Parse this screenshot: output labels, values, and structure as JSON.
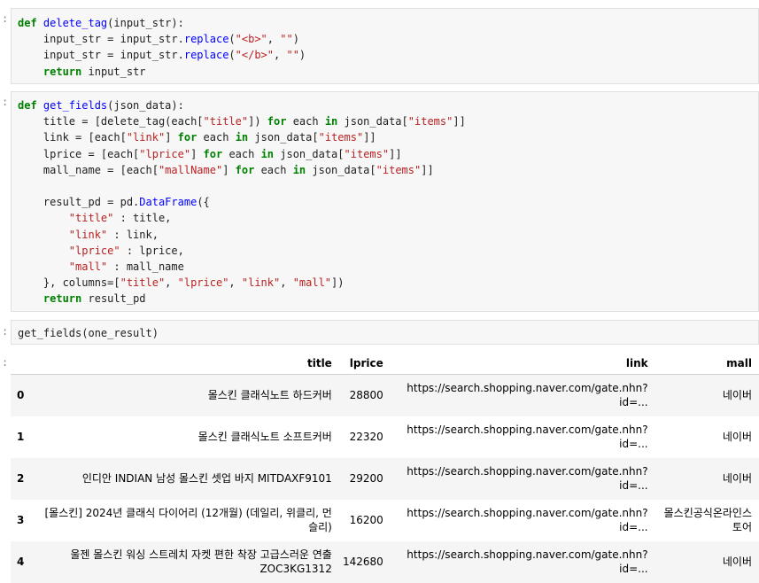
{
  "cells": {
    "cell1": {
      "lines": [
        [
          {
            "t": "def ",
            "c": "kw"
          },
          {
            "t": "delete_tag",
            "c": "fn"
          },
          {
            "t": "(input_str):",
            "c": "pl"
          }
        ],
        [
          {
            "t": "    input_str = input_str.",
            "c": "pl"
          },
          {
            "t": "replace",
            "c": "fn"
          },
          {
            "t": "(",
            "c": "pl"
          },
          {
            "t": "\"<b>\"",
            "c": "st"
          },
          {
            "t": ", ",
            "c": "pl"
          },
          {
            "t": "\"\"",
            "c": "st"
          },
          {
            "t": ")",
            "c": "pl"
          }
        ],
        [
          {
            "t": "    input_str = input_str.",
            "c": "pl"
          },
          {
            "t": "replace",
            "c": "fn"
          },
          {
            "t": "(",
            "c": "pl"
          },
          {
            "t": "\"</b>\"",
            "c": "st"
          },
          {
            "t": ", ",
            "c": "pl"
          },
          {
            "t": "\"\"",
            "c": "st"
          },
          {
            "t": ")",
            "c": "pl"
          }
        ],
        [
          {
            "t": "    ",
            "c": "pl"
          },
          {
            "t": "return",
            "c": "kw"
          },
          {
            "t": " input_str",
            "c": "pl"
          }
        ]
      ]
    },
    "cell2": {
      "lines": [
        [
          {
            "t": "def ",
            "c": "kw"
          },
          {
            "t": "get_fields",
            "c": "fn"
          },
          {
            "t": "(json_data):",
            "c": "pl"
          }
        ],
        [
          {
            "t": "    title = [delete_tag(each[",
            "c": "pl"
          },
          {
            "t": "\"title\"",
            "c": "st"
          },
          {
            "t": "]) ",
            "c": "pl"
          },
          {
            "t": "for",
            "c": "kw"
          },
          {
            "t": " each ",
            "c": "pl"
          },
          {
            "t": "in",
            "c": "kw"
          },
          {
            "t": " json_data[",
            "c": "pl"
          },
          {
            "t": "\"items\"",
            "c": "st"
          },
          {
            "t": "]]",
            "c": "pl"
          }
        ],
        [
          {
            "t": "    link = [each[",
            "c": "pl"
          },
          {
            "t": "\"link\"",
            "c": "st"
          },
          {
            "t": "] ",
            "c": "pl"
          },
          {
            "t": "for",
            "c": "kw"
          },
          {
            "t": " each ",
            "c": "pl"
          },
          {
            "t": "in",
            "c": "kw"
          },
          {
            "t": " json_data[",
            "c": "pl"
          },
          {
            "t": "\"items\"",
            "c": "st"
          },
          {
            "t": "]]",
            "c": "pl"
          }
        ],
        [
          {
            "t": "    lprice = [each[",
            "c": "pl"
          },
          {
            "t": "\"lprice\"",
            "c": "st"
          },
          {
            "t": "] ",
            "c": "pl"
          },
          {
            "t": "for",
            "c": "kw"
          },
          {
            "t": " each ",
            "c": "pl"
          },
          {
            "t": "in",
            "c": "kw"
          },
          {
            "t": " json_data[",
            "c": "pl"
          },
          {
            "t": "\"items\"",
            "c": "st"
          },
          {
            "t": "]]",
            "c": "pl"
          }
        ],
        [
          {
            "t": "    mall_name = [each[",
            "c": "pl"
          },
          {
            "t": "\"mallName\"",
            "c": "st"
          },
          {
            "t": "] ",
            "c": "pl"
          },
          {
            "t": "for",
            "c": "kw"
          },
          {
            "t": " each ",
            "c": "pl"
          },
          {
            "t": "in",
            "c": "kw"
          },
          {
            "t": " json_data[",
            "c": "pl"
          },
          {
            "t": "\"items\"",
            "c": "st"
          },
          {
            "t": "]]",
            "c": "pl"
          }
        ],
        [
          {
            "t": "",
            "c": "pl"
          }
        ],
        [
          {
            "t": "    result_pd = pd.",
            "c": "pl"
          },
          {
            "t": "DataFrame",
            "c": "fn"
          },
          {
            "t": "({",
            "c": "pl"
          }
        ],
        [
          {
            "t": "        ",
            "c": "pl"
          },
          {
            "t": "\"title\"",
            "c": "st"
          },
          {
            "t": " : title,",
            "c": "pl"
          }
        ],
        [
          {
            "t": "        ",
            "c": "pl"
          },
          {
            "t": "\"link\"",
            "c": "st"
          },
          {
            "t": " : link,",
            "c": "pl"
          }
        ],
        [
          {
            "t": "        ",
            "c": "pl"
          },
          {
            "t": "\"lprice\"",
            "c": "st"
          },
          {
            "t": " : lprice,",
            "c": "pl"
          }
        ],
        [
          {
            "t": "        ",
            "c": "pl"
          },
          {
            "t": "\"mall\"",
            "c": "st"
          },
          {
            "t": " : mall_name",
            "c": "pl"
          }
        ],
        [
          {
            "t": "    }, columns=[",
            "c": "pl"
          },
          {
            "t": "\"title\"",
            "c": "st"
          },
          {
            "t": ", ",
            "c": "pl"
          },
          {
            "t": "\"lprice\"",
            "c": "st"
          },
          {
            "t": ", ",
            "c": "pl"
          },
          {
            "t": "\"link\"",
            "c": "st"
          },
          {
            "t": ", ",
            "c": "pl"
          },
          {
            "t": "\"mall\"",
            "c": "st"
          },
          {
            "t": "])",
            "c": "pl"
          }
        ],
        [
          {
            "t": "    ",
            "c": "pl"
          },
          {
            "t": "return",
            "c": "kw"
          },
          {
            "t": " result_pd",
            "c": "pl"
          }
        ]
      ]
    },
    "cell3": {
      "lines": [
        [
          {
            "t": "get_fields(one_result)",
            "c": "pl"
          }
        ]
      ]
    }
  },
  "prompts": {
    "p1": ":",
    "p2": ":",
    "p3": ":",
    "p4": ":"
  },
  "dataframe": {
    "columns": [
      "title",
      "lprice",
      "link",
      "mall"
    ],
    "rows": [
      {
        "index": "0",
        "title": "몰스킨 클래식노트 하드커버",
        "lprice": "28800",
        "link": "https://search.shopping.naver.com/gate.nhn?id=...",
        "mall": "네이버"
      },
      {
        "index": "1",
        "title": "몰스킨 클래식노트 소프트커버",
        "lprice": "22320",
        "link": "https://search.shopping.naver.com/gate.nhn?id=...",
        "mall": "네이버"
      },
      {
        "index": "2",
        "title": "인디안 INDIAN 남성 몰스킨 셋업 바지 MITDAXF9101",
        "lprice": "29200",
        "link": "https://search.shopping.naver.com/gate.nhn?id=...",
        "mall": "네이버"
      },
      {
        "index": "3",
        "title": "[몰스킨] 2024년 클래식 다이어리 (12개월) (데일리, 위클리, 먼슬리)",
        "lprice": "16200",
        "link": "https://search.shopping.naver.com/gate.nhn?id=...",
        "mall": "몰스킨공식온라인스토어"
      },
      {
        "index": "4",
        "title": "울젠 몰스킨 워싱 스트레치 자켓 편한 착장 고급스러운 연출 ZOC3KG1312",
        "lprice": "142680",
        "link": "https://search.shopping.naver.com/gate.nhn?id=...",
        "mall": "네이버"
      }
    ]
  }
}
